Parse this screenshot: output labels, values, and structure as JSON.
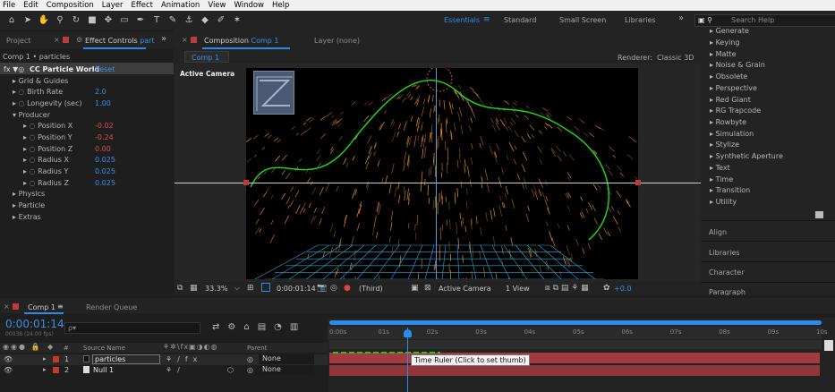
{
  "menu": [
    "File",
    "Edit",
    "Composition",
    "Layer",
    "Effect",
    "Animation",
    "View",
    "Window",
    "Help"
  ],
  "workspaces": {
    "active": "Essentials",
    "items": [
      "Standard",
      "Small Screen",
      "Libraries"
    ],
    "more": "»"
  },
  "search": {
    "placeholder": "Search Help"
  },
  "left_tabs": {
    "project": "Project",
    "effect_controls": "Effect Controls",
    "effect_target": "part"
  },
  "effect_controls": {
    "breadcrumb": "Comp 1 • particles",
    "effect_name": "CC Particle World",
    "reset": "Reset",
    "rows": [
      {
        "label": "Grid & Guides",
        "value": "",
        "color": ""
      },
      {
        "label": "Birth Rate",
        "value": "2.0",
        "color": "blue"
      },
      {
        "label": "Longevity (sec)",
        "value": "1.00",
        "color": "blue"
      },
      {
        "label": "Producer",
        "value": "",
        "color": ""
      },
      {
        "label": "Position X",
        "value": "-0.02",
        "color": "red"
      },
      {
        "label": "Position Y",
        "value": "-0.24",
        "color": "red"
      },
      {
        "label": "Position Z",
        "value": "0.00",
        "color": "red"
      },
      {
        "label": "Radius X",
        "value": "0.025",
        "color": "blue"
      },
      {
        "label": "Radius Y",
        "value": "0.025",
        "color": "blue"
      },
      {
        "label": "Radius Z",
        "value": "0.025",
        "color": "blue"
      },
      {
        "label": "Physics",
        "value": "",
        "color": ""
      },
      {
        "label": "Particle",
        "value": "",
        "color": ""
      },
      {
        "label": "Extras",
        "value": "",
        "color": ""
      }
    ]
  },
  "comp_tabs": {
    "composition_prefix": "Composition",
    "composition_name": "Comp 1",
    "layer": "Layer (none)"
  },
  "comp_subtab": "Comp 1",
  "renderer": {
    "label": "Renderer:",
    "value": "Classic 3D"
  },
  "viewer": {
    "camera_label": "Active Camera"
  },
  "viewer_bar": {
    "zoom": "33.3%",
    "timecode": "0:00:01:14",
    "resolution": "(Third)",
    "camera": "Active Camera",
    "views": "1 View",
    "exposure": "+0.0"
  },
  "effects_list": [
    "Generate",
    "Keying",
    "Matte",
    "Noise & Grain",
    "Obsolete",
    "Perspective",
    "Red Giant",
    "RG Trapcode",
    "Rowbyte",
    "Simulation",
    "Stylize",
    "Synthetic Aperture",
    "Text",
    "Time",
    "Transition",
    "Utility"
  ],
  "right_panels": [
    "Align",
    "Libraries",
    "Character",
    "Paragraph"
  ],
  "timeline": {
    "tab": "Comp 1",
    "render_queue": "Render Queue",
    "timecode": "0:00:01:14",
    "fps": "00038 (24.00 fps)",
    "search_placeholder": "ρ▾",
    "headers": {
      "num": "#",
      "source": "Source Name",
      "parent": "Parent"
    },
    "layers": [
      {
        "num": "1",
        "name": "particles",
        "parent": "None",
        "color": "#c0392b"
      },
      {
        "num": "2",
        "name": "Null 1",
        "parent": "None",
        "color": "#c0392b"
      }
    ],
    "ruler": [
      "0:00s",
      "01s",
      "02s",
      "03s",
      "04s",
      "05s",
      "06s",
      "07s",
      "08s",
      "09s",
      "10s"
    ],
    "tooltip": "Time Ruler (Click to set thumb)"
  },
  "colors": {
    "accent": "#2d8ceb",
    "layer_bar": "#a33a3f",
    "particle": "#e08a2a",
    "path": "#1ed41e",
    "grid": "#2fa8d8"
  }
}
